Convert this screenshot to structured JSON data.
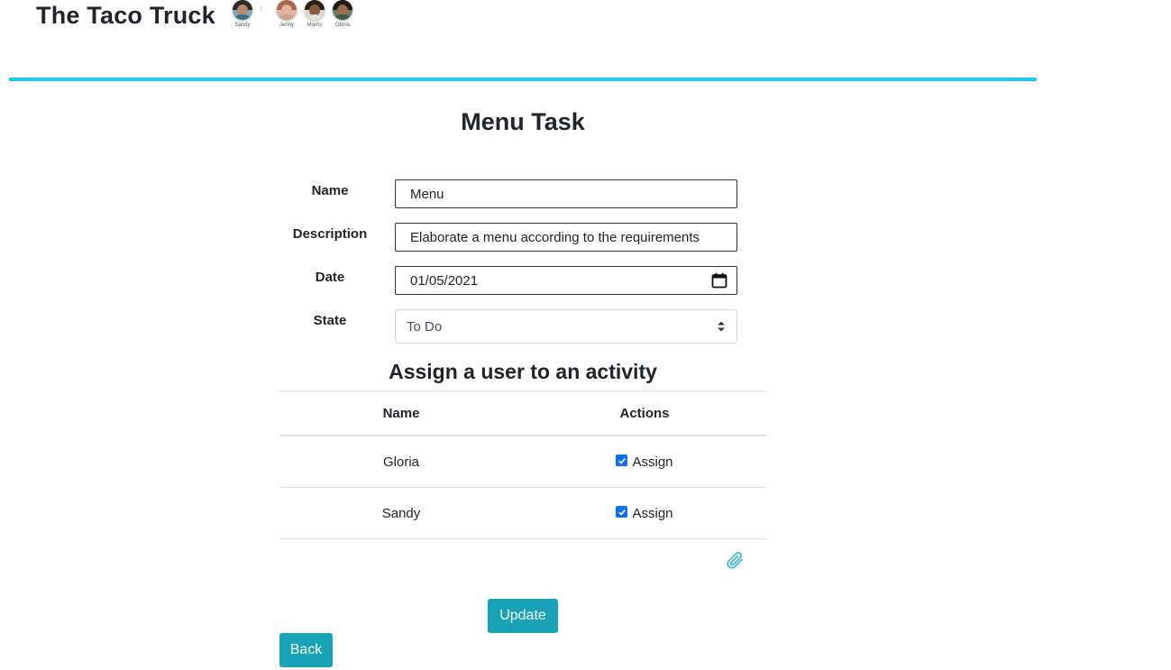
{
  "header": {
    "app_title": "The Taco Truck",
    "avatars": [
      {
        "name": "Sandy",
        "hair": "#2d2a26",
        "skin": "#b98b6e",
        "body": "#3c6e8f",
        "bg": "#7fa7b8"
      },
      {
        "name": "Jenny",
        "hair": "#a8674a",
        "skin": "#e2b49a",
        "body": "#c7a48a",
        "bg": "#d8b8a4"
      },
      {
        "name": "Morris",
        "hair": "#2b2017",
        "skin": "#8a5a3c",
        "body": "#e6e2dc",
        "bg": "#d9d4cc"
      },
      {
        "name": "Gloria",
        "hair": "#1e1a18",
        "skin": "#9c6a4a",
        "body": "#3f5a44",
        "bg": "#6d7e6a"
      }
    ],
    "divider_color": "#1ec8e8"
  },
  "page_title": "Menu Task",
  "form": {
    "name_label": "Name",
    "name_value": "Menu",
    "description_label": "Description",
    "description_value": "Elaborate a menu according to the requirements",
    "date_label": "Date",
    "date_value": "01/05/2021",
    "state_label": "State",
    "state_value": "To Do"
  },
  "assign_section": {
    "title": "Assign a user to an activity",
    "columns": [
      "Name",
      "Actions"
    ],
    "rows": [
      {
        "name": "Gloria",
        "action_label": "Assign",
        "checked": true
      },
      {
        "name": "Sandy",
        "action_label": "Assign",
        "checked": true
      }
    ]
  },
  "buttons": {
    "update_label": "Update",
    "back_label": "Back",
    "accent": "#17a2b8"
  },
  "icons": {
    "attach": "paperclip-icon",
    "date": "calendar-icon",
    "select": "sort-arrows-icon"
  }
}
